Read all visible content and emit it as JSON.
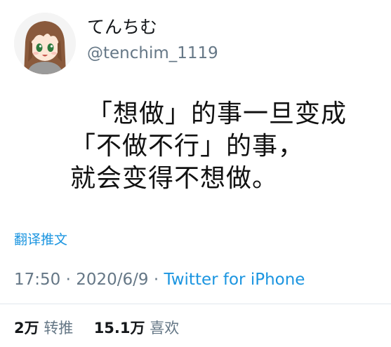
{
  "author": {
    "display_name": "てんちむ",
    "handle": "@tenchim_1119",
    "avatar_icon": "anime-girl-avatar-icon"
  },
  "tweet": {
    "lines": [
      "「想做」的事一旦变成",
      "「不做不行」的事，",
      "就会变得不想做。"
    ],
    "translate_label": "翻译推文",
    "time": "17:50",
    "separator": " · ",
    "date": "2020/6/9",
    "source": "Twitter for iPhone"
  },
  "stats": {
    "retweets_count": "2万",
    "retweets_label": "转推",
    "likes_count": "15.1万",
    "likes_label": "喜欢"
  },
  "colors": {
    "link": "#1b95e0",
    "muted": "#657786",
    "text": "#14171a"
  }
}
